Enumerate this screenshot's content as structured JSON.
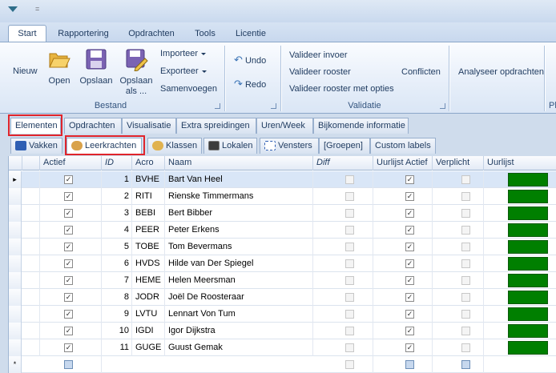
{
  "quick_access": {
    "more": "="
  },
  "ribbon_tabs": [
    "Start",
    "Rapportering",
    "Opdrachten",
    "Tools",
    "Licentie"
  ],
  "ribbon": {
    "nieuw": "Nieuw",
    "open": "Open",
    "opslaan": "Opslaan",
    "opslaan_als_1": "Opslaan",
    "opslaan_als_2": "als ...",
    "importeer": "Importeer",
    "exporteer": "Exporteer",
    "samenvoegen": "Samenvoegen",
    "group_bestand": "Bestand",
    "undo": "Undo",
    "redo": "Redo",
    "valideer_invoer": "Valideer invoer",
    "valideer_rooster": "Valideer rooster",
    "valideer_opties": "Valideer rooster met opties",
    "conflicten": "Conflicten",
    "group_validatie": "Validatie",
    "analyseer": "Analyseer opdrachten",
    "group_cut": "Pl"
  },
  "element_tabs": [
    "Elementen",
    "Opdrachten",
    "Visualisatie",
    "Extra spreidingen",
    "Uren/Week",
    "Bijkomende informatie"
  ],
  "sub_tabs": [
    "Vakken",
    "Leerkrachten",
    "Klassen",
    "Lokalen",
    "Vensters",
    "[Groepen]",
    "Custom labels"
  ],
  "grid": {
    "headers": [
      "Actief",
      "ID",
      "Acro",
      "Naam",
      "Diff",
      "Uurlijst Actief",
      "Verplicht",
      "Uurlijst"
    ],
    "rows": [
      {
        "id": "1",
        "acro": "BVHE",
        "naam": "Bart Van Heel",
        "actief": true,
        "uurlijst_actief": true
      },
      {
        "id": "2",
        "acro": "RITI",
        "naam": "Rienske Timmermans",
        "actief": true,
        "uurlijst_actief": true
      },
      {
        "id": "3",
        "acro": "BEBI",
        "naam": "Bert Bibber",
        "actief": true,
        "uurlijst_actief": true
      },
      {
        "id": "4",
        "acro": "PEER",
        "naam": "Peter Erkens",
        "actief": true,
        "uurlijst_actief": true
      },
      {
        "id": "5",
        "acro": "TOBE",
        "naam": "Tom Bevermans",
        "actief": true,
        "uurlijst_actief": true
      },
      {
        "id": "6",
        "acro": "HVDS",
        "naam": "Hilde van Der Spiegel",
        "actief": true,
        "uurlijst_actief": true
      },
      {
        "id": "7",
        "acro": "HEME",
        "naam": "Helen Meersman",
        "actief": true,
        "uurlijst_actief": true
      },
      {
        "id": "8",
        "acro": "JODR",
        "naam": "Joël De Roosteraar",
        "actief": true,
        "uurlijst_actief": true
      },
      {
        "id": "9",
        "acro": "LVTU",
        "naam": "Lennart Von Tum",
        "actief": true,
        "uurlijst_actief": true
      },
      {
        "id": "10",
        "acro": "IGDI",
        "naam": "Igor Dijkstra",
        "actief": true,
        "uurlijst_actief": true
      },
      {
        "id": "11",
        "acro": "GUGE",
        "naam": "Guust Gemak",
        "actief": true,
        "uurlijst_actief": true
      }
    ],
    "selected_indicator": "▸",
    "new_row_indicator": "*",
    "uurlijst_color": "#007f00"
  }
}
